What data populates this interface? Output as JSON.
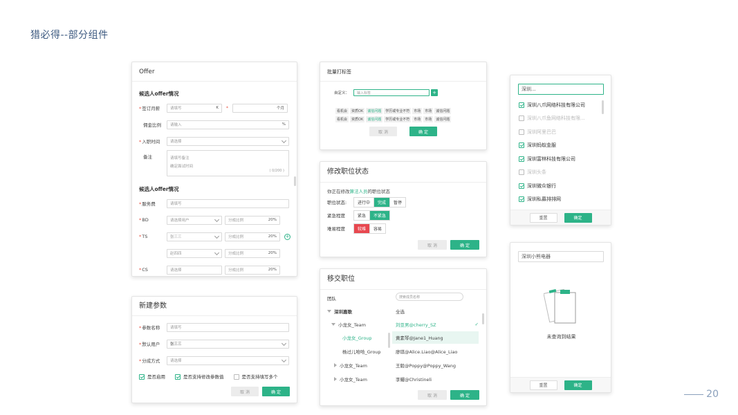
{
  "page": {
    "title": "猎必得--部分组件",
    "page_number": "20"
  },
  "offer": {
    "title": "Offer",
    "section1": "候选人offer情况",
    "salary_label": "签订月薪",
    "salary_placeholder": "请填写",
    "salary_unit": "K",
    "salary_months_unit": "个月",
    "commission_label": "佣金比例",
    "commission_placeholder": "请输入",
    "commission_unit": "%",
    "join_label": "入职时间",
    "join_placeholder": "请选择",
    "note_label": "备注",
    "note_placeholder_1": "请填写备注",
    "note_placeholder_2": "确定面试时间",
    "note_count": "( 0/200 )",
    "section2": "候选人offer情况",
    "fee_label": "服务费",
    "fee_placeholder": "请填写",
    "bd_label": "BD",
    "bd_placeholder": "请选择用户",
    "split_placeholder": "分成比例",
    "pct": "20%",
    "ts_label": "TS",
    "ts_user1": "张三三",
    "ts_user2": "赵四四",
    "cs_label": "CS",
    "cs_placeholder": "请选择"
  },
  "batch": {
    "title": "批量打标签",
    "custom_label": "自定义：",
    "input_placeholder": "输入标签",
    "row1": [
      "看机会",
      "资质OK",
      "诚信问题",
      "学历或专业不符",
      "市场",
      "市场",
      "诚信问题"
    ],
    "row2": [
      "看机会",
      "资质OK",
      "诚信问题",
      "学历或专业不符",
      "市场",
      "市场",
      "诚信问题"
    ],
    "cancel": "取 消",
    "ok": "确 定"
  },
  "status": {
    "title": "修改职位状态",
    "intro_prefix": "你正在修改",
    "intro_link": "算法人员",
    "intro_suffix": "的职位状态",
    "status_label": "职位状态:",
    "status_options": [
      "进行中",
      "完成",
      "暂停"
    ],
    "urgency_label": "紧急程度",
    "urgency_options": [
      "紧急",
      "不紧急"
    ],
    "difficulty_label": "难易程度",
    "difficulty_options": [
      "较难",
      "容易"
    ],
    "cancel": "取 消",
    "ok": "确 定"
  },
  "transfer": {
    "title": "移交职位",
    "team_label": "团队",
    "search_placeholder": "搜索成员名称",
    "tree": [
      "深圳嘉歌",
      "小龙女_Team",
      "小龙女_Group",
      "杨过儿哈哈_Group",
      "小龙女_Team",
      "小龙女_Team"
    ],
    "members": [
      "全选",
      "刘亚男@cherry_SZ",
      "黄素琴@Jane1_Huang",
      "廖琪@Alice.Liao@Alice_Liao",
      "王毅@Poppy@Poppy_Wang",
      "李耀@Christineli"
    ],
    "cancel": "取 消",
    "ok": "确 定"
  },
  "param": {
    "title": "新建参数",
    "name_label": "参数名称",
    "name_placeholder": "请填写",
    "user_label": "默认用户",
    "user_value": "张三三",
    "mode_label": "分成方式",
    "mode_placeholder": "请选择",
    "check1": "是否启用",
    "check2": "是否支持修改参数值",
    "check3": "是否支持填写多个",
    "cancel": "取 消",
    "ok": "确 定"
  },
  "company_filter": {
    "search_value": "深圳...",
    "items": [
      "深圳八爪网络科技有限公司",
      "深圳八爪鱼网络科技有限...",
      "深圳阿里巴巴",
      "深圳蚂蚁金服",
      "深圳富林科技有限公司",
      "深圳头条",
      "深圳微众银行",
      "深圳私募排排网"
    ],
    "reset": "重置",
    "ok": "确定"
  },
  "empty_filter": {
    "search_value": "深圳小熊电器",
    "empty_text": "未查询到结果",
    "reset": "重置",
    "ok": "确定"
  }
}
